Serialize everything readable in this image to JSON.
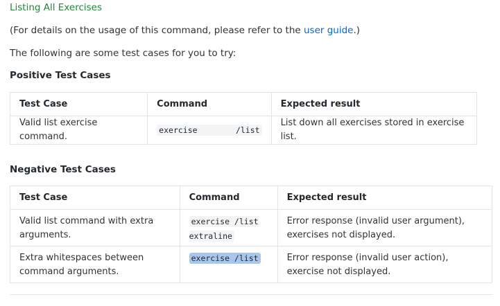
{
  "section_link": "Listing All Exercises",
  "intro": {
    "prefix": "(For details on the usage of this command, please refer to the ",
    "link": "user guide",
    "suffix": ".)"
  },
  "subtitle": "The following are some test cases for you to try:",
  "positive": {
    "heading": "Positive Test Cases",
    "headers": [
      "Test Case",
      "Command",
      "Expected result"
    ],
    "rows": [
      [
        "Valid list exercise command.",
        "exercise        /list",
        "List down all exercises stored in exercise list."
      ]
    ]
  },
  "negative": {
    "heading": "Negative Test Cases",
    "headers": [
      "Test Case",
      "Command",
      "Expected result"
    ],
    "rows": [
      [
        "Valid list command with extra arguments.",
        "exercise /list extraline",
        "Error response (invalid user argument), exercises not displayed."
      ],
      [
        "Extra whitespaces between command arguments.",
        "exercise /list",
        "Error response (invalid user action), exercise not displayed."
      ]
    ]
  }
}
